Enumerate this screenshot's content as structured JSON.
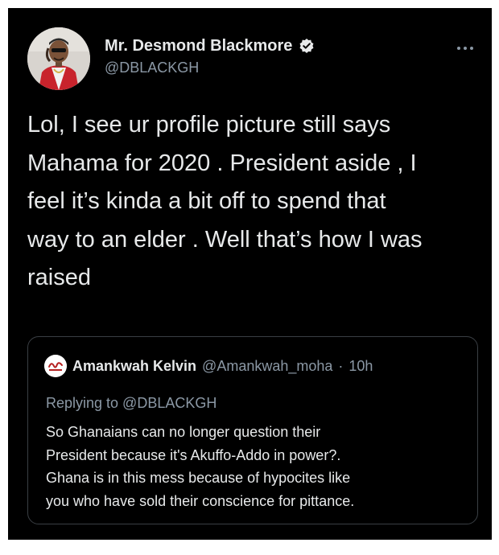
{
  "tweet": {
    "author": {
      "name": "Mr. Desmond Blackmore",
      "handle": "@DBLACKGH",
      "verified": true
    },
    "more_icon": "more-horizontal-icon",
    "text_lines": [
      "Lol, I see ur profile picture still says",
      "Mahama for 2020 . President aside , I",
      "feel it’s kinda a bit off to spend that",
      "way to an elder . Well that’s how I was",
      "raised"
    ]
  },
  "quoted": {
    "author": {
      "name": "Amankwah Kelvin",
      "handle": "@Amankwah_moha",
      "time": "10h"
    },
    "separator": "·",
    "replying_to": "Replying to @DBLACKGH",
    "text_lines": [
      "So Ghanaians can no longer question their",
      "President because it's Akuffo-Addo in power?.",
      "Ghana is in this mess because of hypocites like",
      "you who have sold their conscience for pittance."
    ]
  },
  "colors": {
    "background": "#000000",
    "text": "#e7e9ea",
    "secondary": "#8b98a5",
    "border": "#3a3f44"
  }
}
